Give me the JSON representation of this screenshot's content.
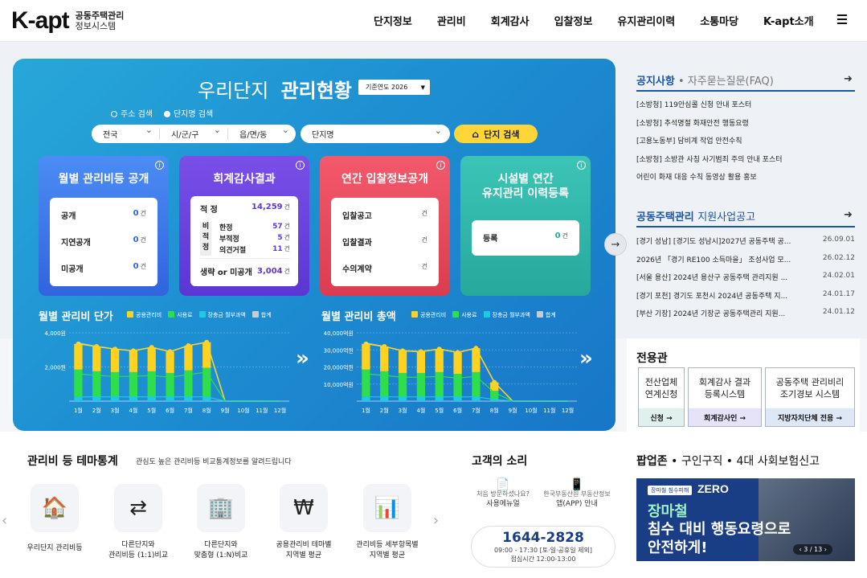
{
  "header": {
    "logo_main": "K-apt",
    "logo_sub1": "공동주택관리",
    "logo_sub2": "정보시스템",
    "nav": [
      "단지정보",
      "관리비",
      "회계감사",
      "입찰정보",
      "유지관리이력",
      "소통마당",
      "K-apt소개"
    ]
  },
  "hero": {
    "title_light": "우리단지",
    "title_bold": "관리현황",
    "year_select": "기준연도 2026",
    "radio_address": "주소 검색",
    "radio_name": "단지명 검색",
    "selects": [
      "전국",
      "시/군/구",
      "읍/면/동"
    ],
    "name_placeholder": "단지명",
    "search_button": "단지 검색",
    "cards": {
      "monthly": {
        "title": "월별 관리비등 공개",
        "rows": [
          {
            "label": "공개",
            "value": "0",
            "unit": "건"
          },
          {
            "label": "지연공개",
            "value": "0",
            "unit": "건"
          },
          {
            "label": "미공개",
            "value": "0",
            "unit": "건"
          }
        ]
      },
      "audit": {
        "title": "회계감사결과",
        "appropriate_label": "적 정",
        "appropriate_value": "14,259",
        "unit": "건",
        "non_label": "비\n적\n정",
        "sub": [
          {
            "label": "한정",
            "value": "57"
          },
          {
            "label": "부적정",
            "value": "5"
          },
          {
            "label": "의견거절",
            "value": "11"
          }
        ],
        "omit_label": "생략 or 미공개",
        "omit_value": "3,004"
      },
      "bid": {
        "title": "연간 입찰정보공개",
        "rows": [
          {
            "label": "입찰공고",
            "value": "",
            "unit": "건"
          },
          {
            "label": "입찰결과",
            "value": "",
            "unit": "건"
          },
          {
            "label": "수의계약",
            "value": "",
            "unit": "건"
          }
        ]
      },
      "facility": {
        "title_line1": "시설별 연간",
        "title_line2": "유지관리 이력등록",
        "row": {
          "label": "등록",
          "value": "0",
          "unit": "건"
        }
      }
    }
  },
  "chart_data": [
    {
      "type": "bar",
      "title": "월별 관리비 단가",
      "categories": [
        "1월",
        "2월",
        "3월",
        "4월",
        "5월",
        "6월",
        "7월",
        "8월",
        "9월",
        "10월",
        "11월",
        "12월"
      ],
      "y_ticks": [
        "4,000원",
        "2,000원"
      ],
      "ylim": [
        0,
        4000
      ],
      "series": [
        {
          "name": "공용관리비",
          "color": "#ffd21f",
          "values": [
            1500,
            1450,
            1350,
            1250,
            1400,
            1250,
            1450,
            1500,
            0,
            0,
            0,
            0
          ]
        },
        {
          "name": "사용료",
          "color": "#2ede4a",
          "values": [
            1600,
            1500,
            1450,
            1450,
            1500,
            1400,
            1550,
            1700,
            0,
            0,
            0,
            0
          ]
        },
        {
          "name": "장충금 월부과액",
          "color": "#1ec9e6",
          "values": [
            250,
            250,
            250,
            250,
            250,
            250,
            250,
            250,
            0,
            0,
            0,
            0
          ]
        },
        {
          "name": "합계",
          "color": "#c8cdd3",
          "values": [
            3400,
            3200,
            3050,
            2950,
            3150,
            2900,
            3250,
            3450,
            0,
            0,
            0,
            0
          ]
        }
      ]
    },
    {
      "type": "bar",
      "title": "월별 관리비 총액",
      "categories": [
        "1월",
        "2월",
        "3월",
        "4월",
        "5월",
        "6월",
        "7월",
        "8월",
        "9월",
        "10월",
        "11월",
        "12월"
      ],
      "y_ticks": [
        "40,000억원",
        "30,000억원",
        "20,000억원",
        "10,000억원"
      ],
      "ylim": [
        0,
        40000
      ],
      "series": [
        {
          "name": "공용관리비",
          "color": "#ffd21f",
          "values": [
            15000,
            14500,
            13000,
            12500,
            13500,
            12500,
            14000,
            5000,
            0,
            0,
            0,
            0
          ]
        },
        {
          "name": "사용료",
          "color": "#2ede4a",
          "values": [
            16000,
            15000,
            14000,
            14000,
            14500,
            13500,
            14500,
            5000,
            0,
            0,
            0,
            0
          ]
        },
        {
          "name": "장충금 월부과액",
          "color": "#1ec9e6",
          "values": [
            2500,
            2500,
            2500,
            2500,
            2500,
            2500,
            2500,
            1000,
            0,
            0,
            0,
            0
          ]
        },
        {
          "name": "합계",
          "color": "#c8cdd3",
          "values": [
            34000,
            32000,
            29500,
            29000,
            30500,
            28500,
            31000,
            11000,
            0,
            0,
            0,
            0
          ]
        }
      ]
    }
  ],
  "notice": {
    "title": "공지사항",
    "faq": "자주묻는질문(FAQ)",
    "items": [
      "[소방청] 119안심콜 신청 안내 포스터",
      "[소방청] 추석명절 화재안전 행동요령",
      "[고용노동부] 담비계 작업 안전수칙",
      "[소방청] 소방관 사칭 사기범죄 주의 안내 포스터",
      "어린이 화재 대응 수칙 동영상 활용 홍보"
    ]
  },
  "support": {
    "title_dark": "공동주택관리",
    "title_light": "지원사업공고",
    "items": [
      {
        "title": "[경기 성남] [경기도 성남시]2027년 공동주택 공...",
        "date": "26.09.01"
      },
      {
        "title": "2026년 「경기 RE100 소득마을」 조성사업 모...",
        "date": "26.02.12"
      },
      {
        "title": "[서울 용산] 2024년 용산구 공동주택 관리지원 ...",
        "date": "24.02.01"
      },
      {
        "title": "[경기 포천] 경기도 포천시 2024년 공동주택 지...",
        "date": "24.01.17"
      },
      {
        "title": "[부산 기장] 2024년 기장군 공동주택관리 지원...",
        "date": "24.01.12"
      }
    ]
  },
  "dedicated": {
    "title": "전용관",
    "boxes": [
      {
        "text": "전산업체\n연계신청",
        "button": "신청 →"
      },
      {
        "text": "회계감사 결과\n등록시스템",
        "button": "회계감사인 →"
      },
      {
        "text": "공동주택 관리비리\n조기경보 시스템",
        "button": "지방자치단체 전용 →"
      }
    ]
  },
  "theme": {
    "title": "관리비 등 테마통계",
    "subtitle": "관심도 높은 관리비등 비교통계정보를 알려드립니다",
    "items": [
      {
        "label": "우리단지 관리비등",
        "icon": "house-coins-icon"
      },
      {
        "label": "다른단지와\n관리비등 (1:1)비교",
        "icon": "compare-icon"
      },
      {
        "label": "다른단지와\n맞춤형 (1:N)비교",
        "icon": "building-icon"
      },
      {
        "label": "공용관리비 테마별\n지역별 평균",
        "icon": "won-icon"
      },
      {
        "label": "관리비등 세부항목별\n지역별 평균",
        "icon": "chart-doc-icon"
      }
    ]
  },
  "voice": {
    "title": "고객의 소리",
    "manual_line1": "처음 방문하셨나요?",
    "manual_line2": "사용메뉴얼",
    "app_line1": "한국부동산원 부동산정보",
    "app_line2": "앱(APP) 안내",
    "phone": "1644-2828",
    "hours": "09:00 - 17:30 [토·일·공휴일 제외]",
    "lunch": "점심시간 12:00-13:00"
  },
  "popup": {
    "zone_title": "팝업존",
    "links": [
      "구인구직",
      "4대 사회보험신고"
    ],
    "badge": "장마철 침수피해",
    "zero": "ZERO",
    "line1": "장마철",
    "line2": "침수 대비 행동요령으로",
    "line3": "안전하게!",
    "pager": "3 / 13"
  }
}
